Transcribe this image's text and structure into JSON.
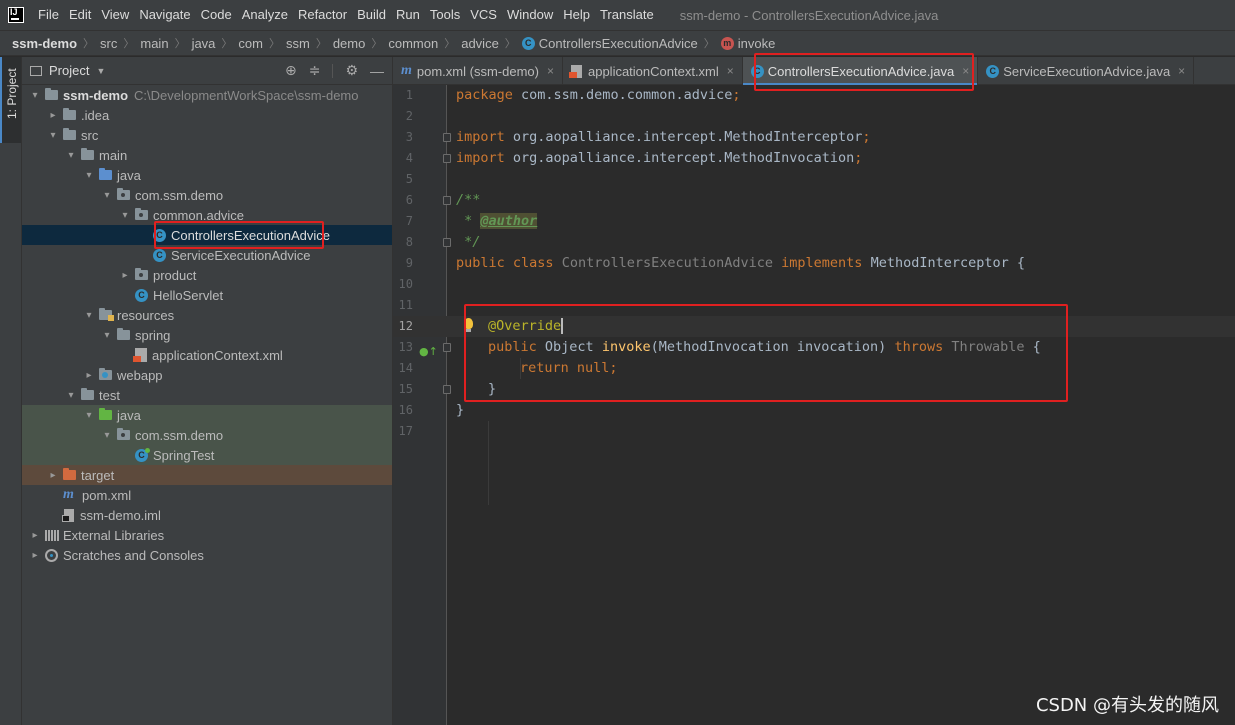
{
  "menu": [
    "File",
    "Edit",
    "View",
    "Navigate",
    "Code",
    "Analyze",
    "Refactor",
    "Build",
    "Run",
    "Tools",
    "VCS",
    "Window",
    "Help",
    "Translate"
  ],
  "window_title": "ssm-demo - ControllersExecutionAdvice.java",
  "breadcrumb": [
    "ssm-demo",
    "src",
    "main",
    "java",
    "com",
    "ssm",
    "demo",
    "common",
    "advice",
    "ControllersExecutionAdvice",
    "invoke"
  ],
  "tool_window": {
    "strip_label": "1: Project",
    "title": "Project"
  },
  "tree": {
    "root_name": "ssm-demo",
    "root_path": "C:\\DevelopmentWorkSpace\\ssm-demo",
    "idea": ".idea",
    "src": "src",
    "main": "main",
    "main_java": "java",
    "pkg_main": "com.ssm.demo",
    "common_advice": "common.advice",
    "controllers_advice": "ControllersExecutionAdvice",
    "service_advice": "ServiceExecutionAdvice",
    "product": "product",
    "hello_servlet": "HelloServlet",
    "resources": "resources",
    "spring": "spring",
    "app_context": "applicationContext.xml",
    "webapp": "webapp",
    "test": "test",
    "test_java": "java",
    "pkg_test": "com.ssm.demo",
    "spring_test": "SpringTest",
    "target": "target",
    "pom": "pom.xml",
    "iml": "ssm-demo.iml",
    "external_libraries": "External Libraries",
    "scratches": "Scratches and Consoles"
  },
  "tabs": [
    {
      "label": "pom.xml (ssm-demo)",
      "icon": "maven-icon"
    },
    {
      "label": "applicationContext.xml",
      "icon": "xml-icon"
    },
    {
      "label": "ControllersExecutionAdvice.java",
      "icon": "class-icon",
      "active": true
    },
    {
      "label": "ServiceExecutionAdvice.java",
      "icon": "class-icon"
    }
  ],
  "code": {
    "line_numbers": [
      "1",
      "2",
      "3",
      "4",
      "5",
      "6",
      "7",
      "8",
      "9",
      "10",
      "11",
      "12",
      "13",
      "14",
      "15",
      "16",
      "17"
    ],
    "kw_package": "package",
    "package_name": " com.ssm.demo.common.advice",
    "kw_import": "import",
    "import1": " org.aopalliance.intercept.MethodInterceptor",
    "import2": " org.aopalliance.intercept.MethodInvocation",
    "semicolon": ";",
    "doc_open": "/**",
    "doc_star": " * ",
    "doc_author": "@author",
    "doc_close": " */",
    "kw_public": "public",
    "kw_class": " class ",
    "class_name": "ControllersExecutionAdvice",
    "kw_implements": " implements ",
    "interface_name": "MethodInterceptor {",
    "annotation": "@Override",
    "m_public": "public",
    "m_return_type": " Object ",
    "m_name": "invoke",
    "m_params": "(MethodInvocation invocation) ",
    "kw_throws": "throws",
    "throwable": " Throwable",
    "open_brace": " {",
    "kw_return": "return",
    "kw_null": " null",
    "inner_close": "}",
    "outer_close": "}"
  },
  "watermark": "CSDN @有头发的随风",
  "colors": {
    "annotation_box": "#e02020",
    "selection": "#0d293e",
    "accent": "#4a88c7"
  }
}
